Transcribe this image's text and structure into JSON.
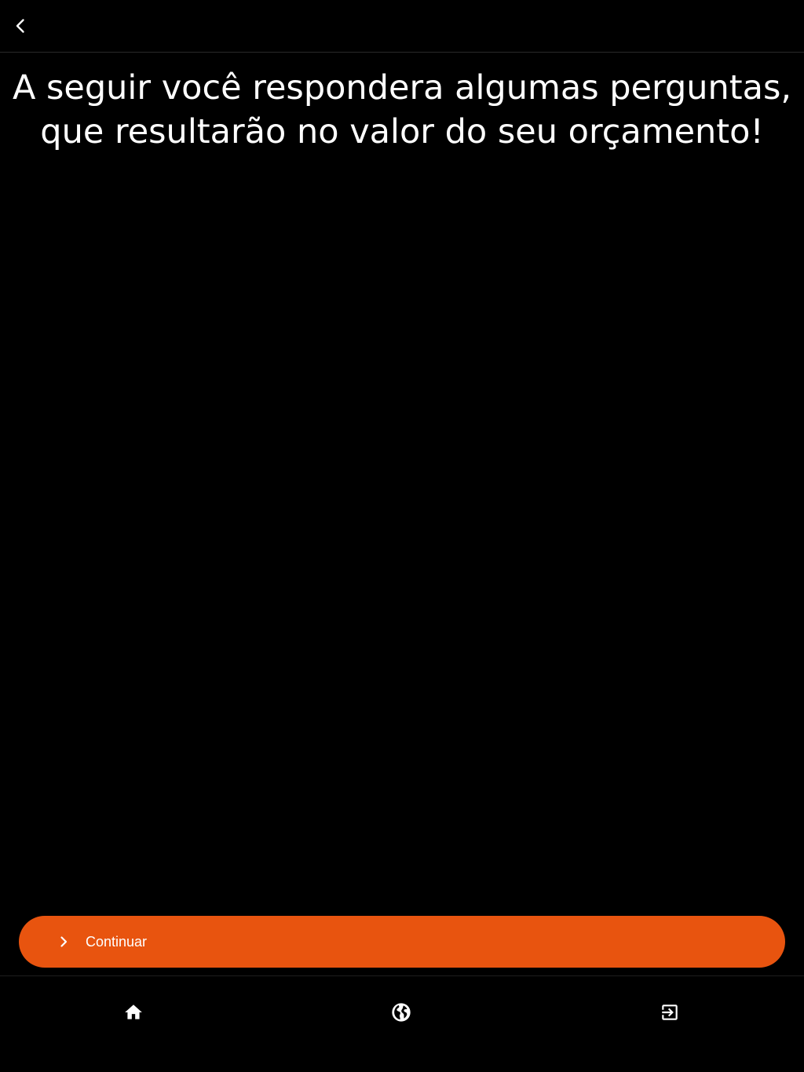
{
  "header": {
    "back_icon": "chevron-left-icon"
  },
  "main": {
    "headline_line1": "A seguir você respondera algumas perguntas,",
    "headline_line2": "que resultarão no valor do seu orçamento!"
  },
  "continue_button": {
    "icon": "chevron-right-icon",
    "label": "Continuar",
    "color": "#e8540f"
  },
  "bottom_nav": {
    "items": [
      {
        "icon": "home-icon"
      },
      {
        "icon": "globe-icon"
      },
      {
        "icon": "exit-icon"
      }
    ]
  }
}
